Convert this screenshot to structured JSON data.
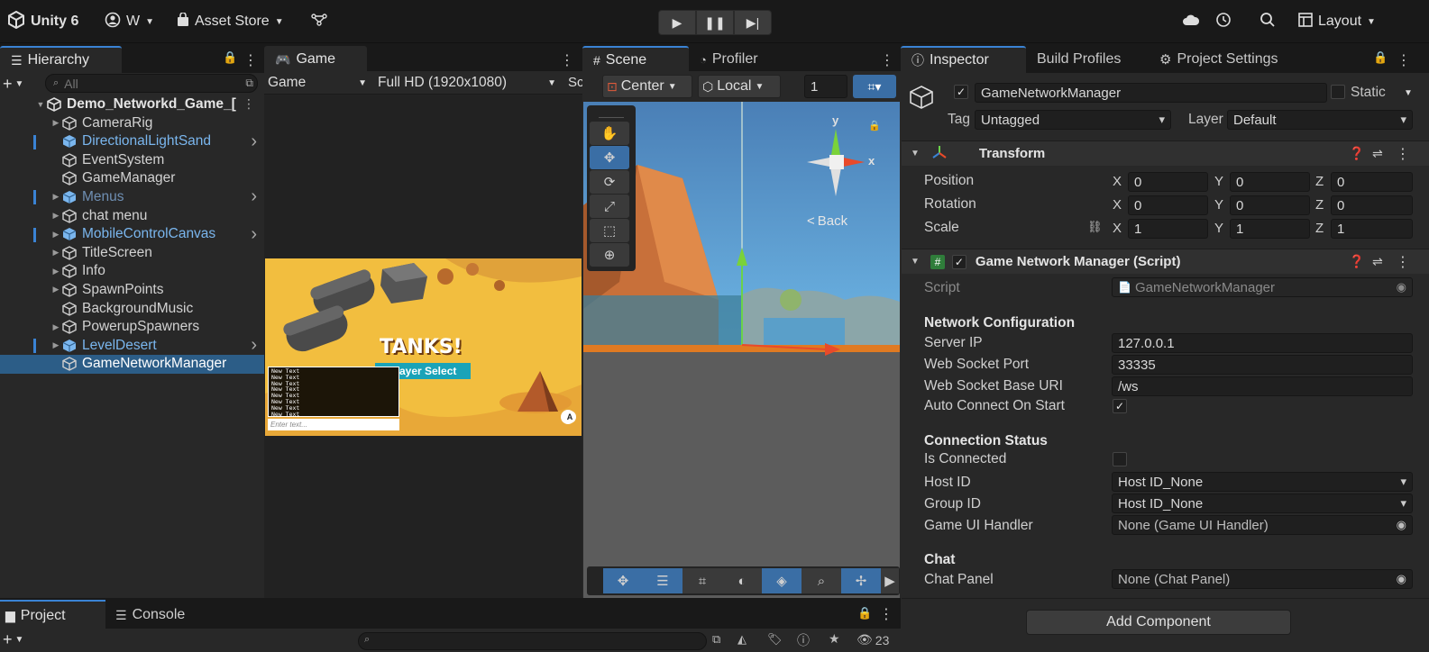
{
  "toolbar": {
    "app_name": "Unity 6",
    "account": "W",
    "asset_store": "Asset Store",
    "layout": "Layout"
  },
  "hierarchy": {
    "tab": "Hierarchy",
    "search_placeholder": "All",
    "root": "Demo_Networkd_Game_[",
    "items": [
      {
        "label": "CameraRig"
      },
      {
        "label": "DirectionalLightSand"
      },
      {
        "label": "EventSystem"
      },
      {
        "label": "GameManager"
      },
      {
        "label": "Menus"
      },
      {
        "label": "chat menu"
      },
      {
        "label": "MobileControlCanvas"
      },
      {
        "label": "TitleScreen"
      },
      {
        "label": "Info"
      },
      {
        "label": "SpawnPoints"
      },
      {
        "label": "BackgroundMusic"
      },
      {
        "label": "PowerupSpawners"
      },
      {
        "label": "LevelDesert"
      },
      {
        "label": "GameNetworkManager"
      }
    ]
  },
  "game": {
    "tab": "Game",
    "display": "Game",
    "resolution": "Full HD (1920x1080)",
    "scale_cut": "Sc",
    "title_overlay": "TANKS!",
    "subtitle_overlay": "Player Select",
    "chat_lines": [
      "New Text",
      "New Text",
      "New Text",
      "New Text",
      "New Text",
      "New Text",
      "New Text",
      "New Text"
    ],
    "chat_placeholder": "Enter text...",
    "badge": "A"
  },
  "scene": {
    "tab": "Scene",
    "profiler_tab": "Profiler",
    "pivot": "Center",
    "space": "Local",
    "grid_value": "1",
    "back": "Back",
    "axis_x": "x",
    "axis_y": "y"
  },
  "inspector": {
    "tabs": [
      "Inspector",
      "Build Profiles",
      "Project Settings"
    ],
    "object_name": "GameNetworkManager",
    "static_label": "Static",
    "tag_label": "Tag",
    "tag_value": "Untagged",
    "layer_label": "Layer",
    "layer_value": "Default",
    "transform": {
      "title": "Transform",
      "position_label": "Position",
      "rotation_label": "Rotation",
      "scale_label": "Scale",
      "x": "X",
      "y": "Y",
      "z": "Z",
      "position": [
        "0",
        "0",
        "0"
      ],
      "rotation": [
        "0",
        "0",
        "0"
      ],
      "scale": [
        "1",
        "1",
        "1"
      ]
    },
    "script": {
      "title": "Game Network Manager (Script)",
      "script_label": "Script",
      "script_value": "GameNetworkManager",
      "net_header": "Network Configuration",
      "server_ip_label": "Server IP",
      "server_ip": "127.0.0.1",
      "ws_port_label": "Web Socket Port",
      "ws_port": "33335",
      "ws_uri_label": "Web Socket Base URI",
      "ws_uri": "/ws",
      "auto_connect_label": "Auto Connect On Start",
      "conn_header": "Connection Status",
      "is_connected_label": "Is Connected",
      "host_id_label": "Host ID",
      "host_id": "Host ID_None",
      "group_id_label": "Group ID",
      "group_id": "Host ID_None",
      "ui_handler_label": "Game UI Handler",
      "ui_handler": "None (Game UI Handler)",
      "chat_header": "Chat",
      "chat_panel_label": "Chat Panel",
      "chat_panel": "None (Chat Panel)"
    },
    "add_component": "Add Component"
  },
  "bottom": {
    "project_tab": "Project",
    "console_tab": "Console",
    "hidden_count": "23"
  }
}
